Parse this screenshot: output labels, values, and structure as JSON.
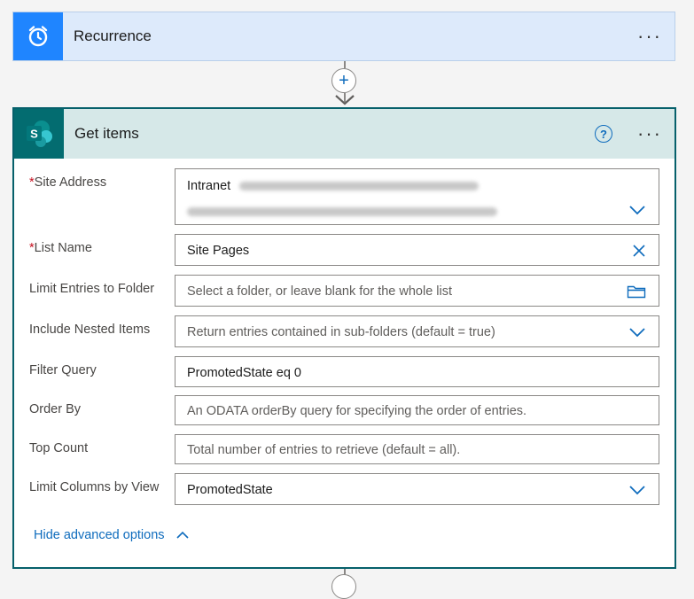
{
  "recurrence": {
    "title": "Recurrence",
    "more_label": "···"
  },
  "connector": {
    "plus_label": "+"
  },
  "get_items": {
    "title": "Get items",
    "help_label": "?",
    "more_label": "···",
    "fields": {
      "site_address": {
        "label": "Site Address",
        "required_mark": "*",
        "value": "Intranet"
      },
      "list_name": {
        "label": "List Name",
        "required_mark": "*",
        "value": "Site Pages"
      },
      "limit_folder": {
        "label": "Limit Entries to Folder",
        "placeholder": "Select a folder, or leave blank for the whole list"
      },
      "nested": {
        "label": "Include Nested Items",
        "placeholder": "Return entries contained in sub-folders (default = true)"
      },
      "filter": {
        "label": "Filter Query",
        "value": "PromotedState eq 0"
      },
      "order_by": {
        "label": "Order By",
        "placeholder": "An ODATA orderBy query for specifying the order of entries."
      },
      "top_count": {
        "label": "Top Count",
        "placeholder": "Total number of entries to retrieve (default = all)."
      },
      "limit_view": {
        "label": "Limit Columns by View",
        "value": "PromotedState"
      }
    },
    "advanced_toggle": "Hide advanced options"
  },
  "colors": {
    "accent": "#0f6cbd",
    "recurrence_blue": "#1f85ff",
    "sharepoint_teal": "#036c70"
  }
}
